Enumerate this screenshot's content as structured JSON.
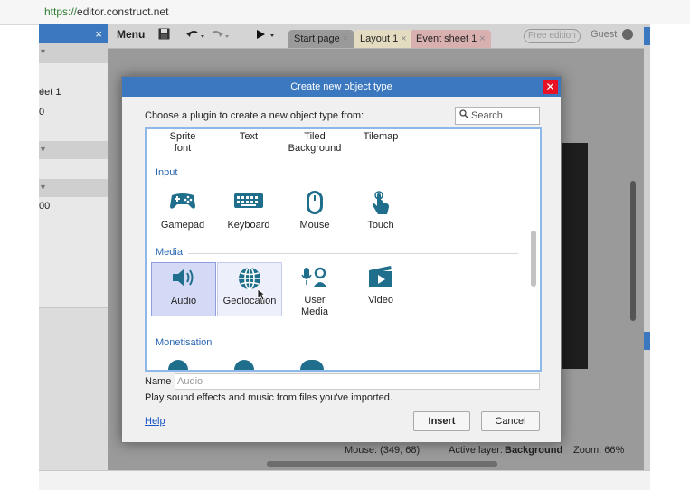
{
  "browser": {
    "url_scheme": "https://",
    "url_host": "editor.construct.net"
  },
  "left_panel": {
    "close": "×",
    "rows": [
      {
        "text": "",
        "arrow": "▼",
        "dark": true
      },
      {
        "text": "",
        "arrow": "",
        "dark": false
      },
      {
        "text": "eet 1",
        "arrow": "⬍",
        "dark": false
      },
      {
        "text": "0",
        "arrow": "",
        "dark": false
      },
      {
        "text": "",
        "arrow": "",
        "dark": false
      },
      {
        "text": "",
        "arrow": "▼",
        "dark": true
      },
      {
        "text": "",
        "arrow": "",
        "dark": false
      },
      {
        "text": "",
        "arrow": "▼",
        "dark": true
      },
      {
        "text": "00",
        "arrow": "",
        "dark": false
      },
      {
        "text": "",
        "arrow": "",
        "dark": false
      },
      {
        "text": "",
        "arrow": "",
        "dark": false
      },
      {
        "text": "",
        "arrow": "",
        "dark": false
      },
      {
        "text": "",
        "arrow": "",
        "dark": false
      },
      {
        "text": "",
        "arrow": "",
        "dark": false
      }
    ]
  },
  "toolbar": {
    "menu_label": "Menu",
    "tabs": [
      {
        "label": "Start page",
        "close": "×"
      },
      {
        "label": "Layout 1",
        "close": "×"
      },
      {
        "label": "Event sheet 1",
        "close": "×"
      }
    ],
    "edition": "Free edition",
    "user": "Guest"
  },
  "statusbar": {
    "mouse": "Mouse: (349, 68)",
    "layer_label": "Active layer:",
    "layer_value": "Background",
    "zoom": "Zoom: 66%"
  },
  "dialog": {
    "title": "Create new object type",
    "instruction": "Choose a plugin to create a new object type from:",
    "search_placeholder": "Search",
    "top_row": [
      {
        "label": "Sprite\nfont"
      },
      {
        "label": "Text"
      },
      {
        "label": "Tiled\nBackground"
      },
      {
        "label": "Tilemap"
      }
    ],
    "categories": [
      {
        "name": "Input",
        "items": [
          {
            "label": "Gamepad",
            "icon": "gamepad-icon"
          },
          {
            "label": "Keyboard",
            "icon": "keyboard-icon"
          },
          {
            "label": "Mouse",
            "icon": "mouse-icon"
          },
          {
            "label": "Touch",
            "icon": "touch-icon"
          }
        ]
      },
      {
        "name": "Media",
        "items": [
          {
            "label": "Audio",
            "icon": "audio-icon",
            "selected": true
          },
          {
            "label": "Geolocation",
            "icon": "geolocation-icon",
            "hover": true
          },
          {
            "label": "User\nMedia",
            "icon": "user-media-icon"
          },
          {
            "label": "Video",
            "icon": "video-icon"
          }
        ]
      },
      {
        "name": "Monetisation",
        "items": []
      }
    ],
    "name_label": "Name",
    "name_value": "Audio",
    "description": "Play sound effects and music from files you've imported.",
    "help": "Help",
    "insert": "Insert",
    "cancel": "Cancel",
    "accent": "#1f6e8c"
  }
}
